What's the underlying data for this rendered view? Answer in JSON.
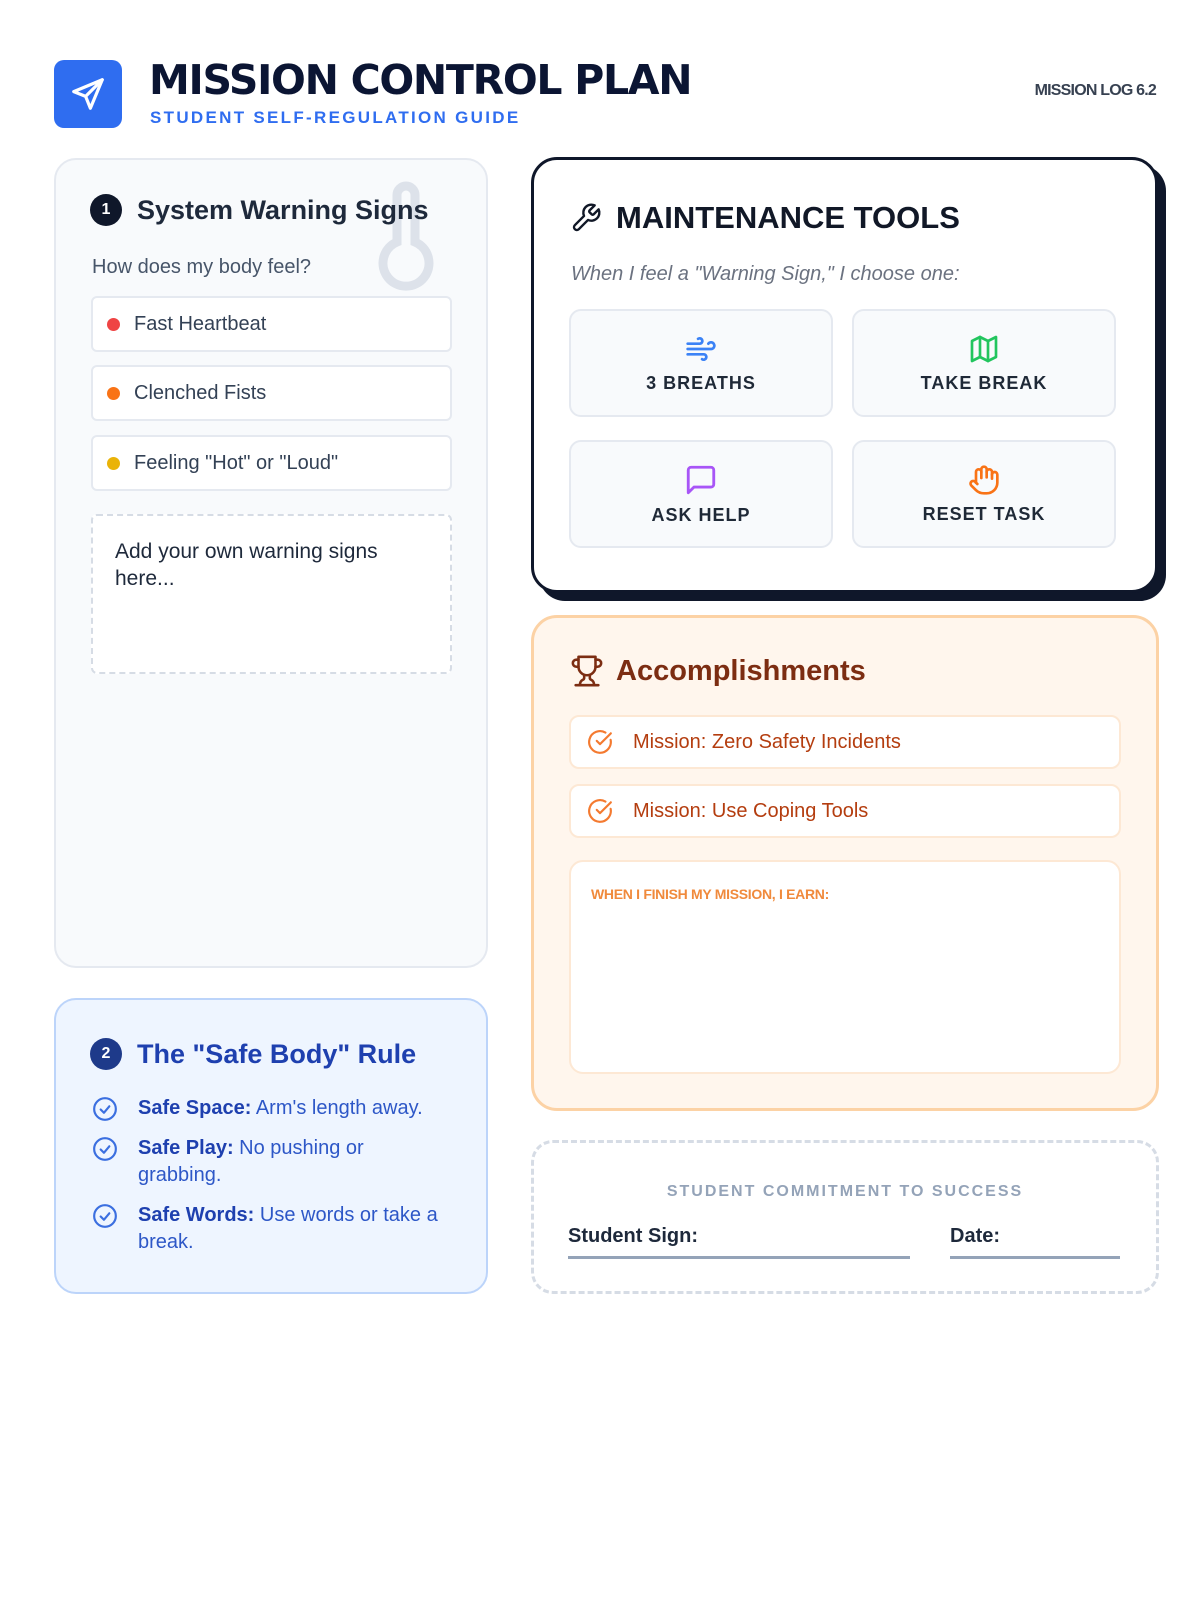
{
  "header": {
    "title": "MISSION CONTROL PLAN",
    "subtitle": "STUDENT SELF-REGULATION GUIDE",
    "log": "MISSION LOG 6.2",
    "logo_icon": "paper-plane-icon",
    "accent": "#2f6df0"
  },
  "warning": {
    "number": "1",
    "title": "System Warning Signs",
    "question": "How does my body feel?",
    "signs": [
      {
        "label": "Fast Heartbeat",
        "color": "#ef4444"
      },
      {
        "label": "Clenched Fists",
        "color": "#f97316"
      },
      {
        "label": "Feeling \"Hot\" or \"Loud\"",
        "color": "#eab308"
      }
    ],
    "add_own": "Add your own warning signs here...",
    "decor_icon": "thermometer-icon"
  },
  "safe_body": {
    "number": "2",
    "title": "The \"Safe Body\" Rule",
    "rules": [
      {
        "bold": "Safe Space:",
        "text": " Arm's length away."
      },
      {
        "bold": "Safe Play:",
        "text": " No pushing or grabbing."
      },
      {
        "bold": "Safe Words:",
        "text": " Use words or take a break."
      }
    ]
  },
  "tools": {
    "title": "MAINTENANCE TOOLS",
    "note": "When I feel a \"Warning Sign,\" I choose one:",
    "items": [
      {
        "label": "3 BREATHS",
        "icon": "wind-icon",
        "color": "#3b82f6"
      },
      {
        "label": "TAKE BREAK",
        "icon": "map-icon",
        "color": "#22c55e"
      },
      {
        "label": "ASK HELP",
        "icon": "message-square-icon",
        "color": "#a855f7"
      },
      {
        "label": "RESET TASK",
        "icon": "hand-icon",
        "color": "#f97316"
      }
    ]
  },
  "accomplishments": {
    "title": "Accomplishments",
    "items": [
      "Mission: Zero Safety Incidents",
      "Mission: Use Coping Tools"
    ],
    "earn_label": "WHEN I FINISH MY MISSION, I EARN:"
  },
  "commitment": {
    "label": "STUDENT COMMITMENT TO SUCCESS",
    "sign_label": "Student Sign:",
    "date_label": "Date:"
  }
}
